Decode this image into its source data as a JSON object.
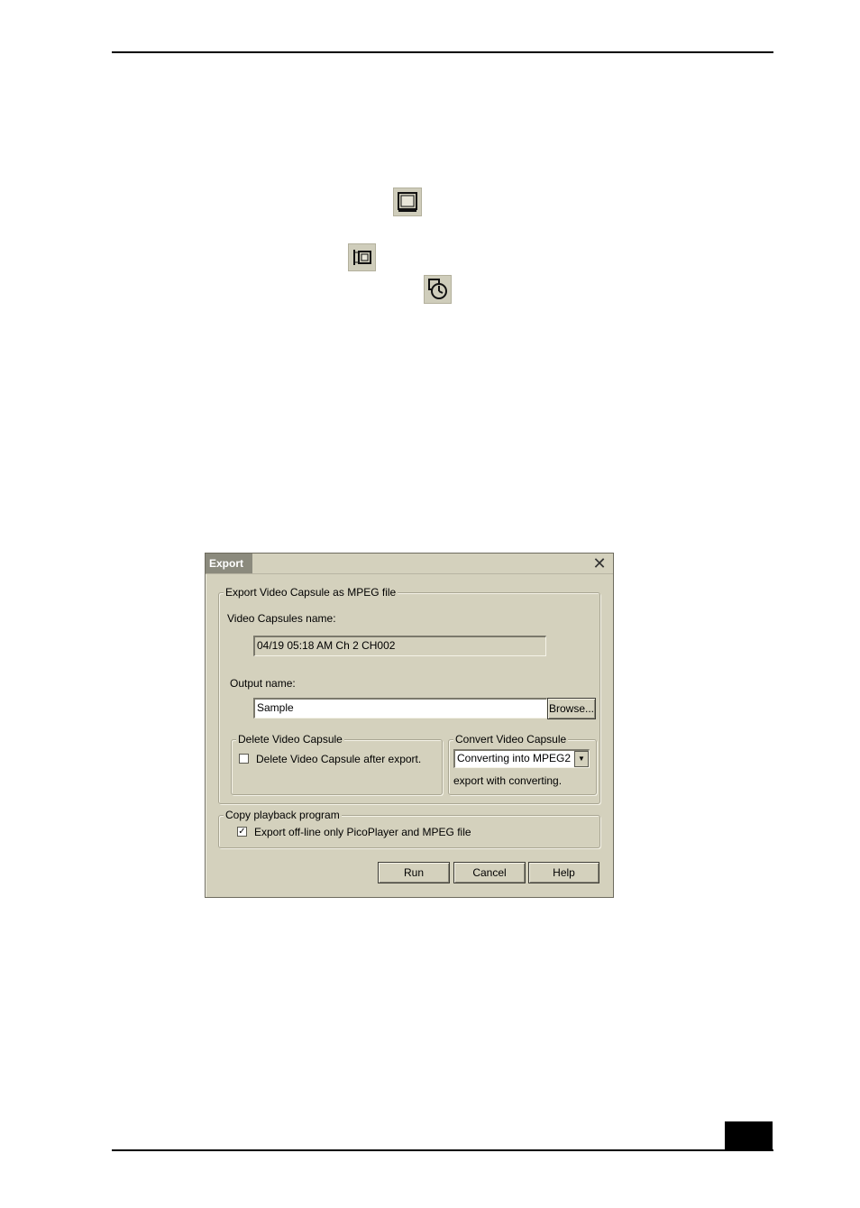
{
  "icons": {
    "screen_icon": "screen-icon",
    "camera_icon": "video-camera-icon",
    "timer_icon": "timer-clock-icon"
  },
  "dialog": {
    "title": "Export",
    "close_glyph": "✕",
    "export_group_label": "Export Video Capsule as MPEG file",
    "capsules_name_label": "Video Capsules name:",
    "capsules_name_value": "04/19 05:18 AM Ch 2 CH002",
    "output_name_label": "Output name:",
    "output_name_value": "Sample",
    "browse_label": "Browse...",
    "delete_group_label": "Delete Video Capsule",
    "delete_checkbox_label": "Delete Video Capsule after export.",
    "delete_checked": false,
    "convert_group_label": "Convert Video Capsule",
    "convert_selected": "Converting into MPEG2",
    "convert_note": "export with converting.",
    "copy_group_label": "Copy playback program",
    "copy_checkbox_label": "Export off-line only PicoPlayer and MPEG file",
    "copy_checked": true,
    "copy_check_glyph": "✓",
    "run_label": "Run",
    "cancel_label": "Cancel",
    "help_label": "Help"
  }
}
